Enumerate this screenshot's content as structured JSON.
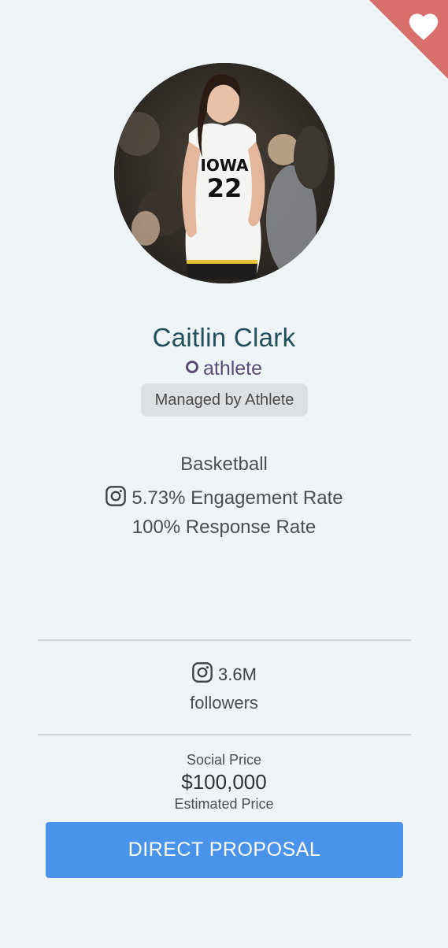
{
  "profile": {
    "name": "Caitlin Clark",
    "role": "athlete",
    "managed_badge": "Managed by Athlete",
    "avatar_icon": "athlete-photo"
  },
  "stats": {
    "sport": "Basketball",
    "engagement_rate": "5.73% Engagement Rate",
    "response_rate": "100% Response Rate",
    "engagement_icon": "instagram-icon"
  },
  "social": {
    "followers_count": "3.6M",
    "followers_label": "followers",
    "platform_icon": "instagram-icon"
  },
  "pricing": {
    "label": "Social Price",
    "value": "$100,000",
    "note": "Estimated Price"
  },
  "actions": {
    "proposal_label": "DIRECT PROPOSAL",
    "favorite_icon": "heart-icon"
  },
  "colors": {
    "favorite_corner": "#d9706d",
    "name": "#21505c",
    "role": "#5b4c77",
    "button": "#4a93ea",
    "background": "#eef3f6"
  },
  "jersey": {
    "team": "IOWA",
    "number": "22"
  }
}
